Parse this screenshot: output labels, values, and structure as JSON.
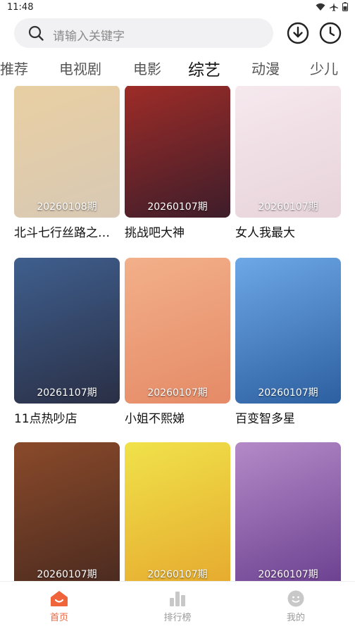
{
  "status_bar": {
    "time": "11:48"
  },
  "search": {
    "placeholder": "请输入关键字"
  },
  "tabs": [
    {
      "label": "推荐"
    },
    {
      "label": "电视剧"
    },
    {
      "label": "电影"
    },
    {
      "label": "综艺"
    },
    {
      "label": "动漫"
    },
    {
      "label": "少儿"
    }
  ],
  "active_tab": "综艺",
  "items": [
    {
      "title": "北斗七行丝路之…",
      "episode": "20260108期",
      "poster_colors": [
        "#e9cfa2",
        "#d8c9b5"
      ]
    },
    {
      "title": "挑战吧大神",
      "episode": "20260107期",
      "poster_colors": [
        "#9e2c28",
        "#3d1d2a"
      ]
    },
    {
      "title": "女人我最大",
      "episode": "20260107期",
      "poster_colors": [
        "#f6e9ee",
        "#e7d3da"
      ]
    },
    {
      "title": "11点热吵店",
      "episode": "20261107期",
      "poster_colors": [
        "#3f5f8e",
        "#2a2f45"
      ]
    },
    {
      "title": "小姐不熙娣",
      "episode": "20260107期",
      "poster_colors": [
        "#f2b08a",
        "#e58a66"
      ]
    },
    {
      "title": "百变智多星",
      "episode": "20260107期",
      "poster_colors": [
        "#6ea8e6",
        "#2c5fa0"
      ]
    },
    {
      "title": "",
      "episode": "20260107期",
      "poster_colors": [
        "#8a4a2a",
        "#4a2a20"
      ]
    },
    {
      "title": "",
      "episode": "20260107期",
      "poster_colors": [
        "#f0e24a",
        "#e6a92e"
      ]
    },
    {
      "title": "",
      "episode": "20260107期",
      "poster_colors": [
        "#b48ac8",
        "#6a3f8f"
      ]
    }
  ],
  "bottom_nav": [
    {
      "label": "首页",
      "icon": "home-icon"
    },
    {
      "label": "排行榜",
      "icon": "ranking-icon"
    },
    {
      "label": "我的",
      "icon": "profile-icon"
    }
  ],
  "colors": {
    "accent": "#f0643c",
    "inactive": "#9a9a9a"
  }
}
